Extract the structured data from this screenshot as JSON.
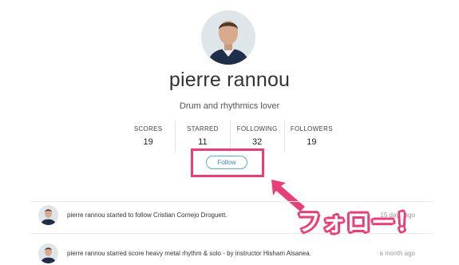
{
  "profile": {
    "name": "pierre rannou",
    "bio": "Drum and rhythmics lover"
  },
  "stats": [
    {
      "label": "SCORES",
      "value": "19"
    },
    {
      "label": "STARRED",
      "value": "11"
    },
    {
      "label": "FOLLOWING",
      "value": "32"
    },
    {
      "label": "FOLLOWERS",
      "value": "19"
    }
  ],
  "follow_button": {
    "label": "Follow"
  },
  "activity": [
    {
      "text": "pierre rannou started to follow Cristian Cornejo Droguett.",
      "time": "15 days ago"
    },
    {
      "text": "pierre rannou starred score heavy metal rhythm & solo - by instructor Hisham Alsanea.",
      "time": "a month ago"
    }
  ],
  "annotation": {
    "text": "フォロー！"
  },
  "colors": {
    "highlight": "#e83f78",
    "link": "#3b8fc4"
  }
}
